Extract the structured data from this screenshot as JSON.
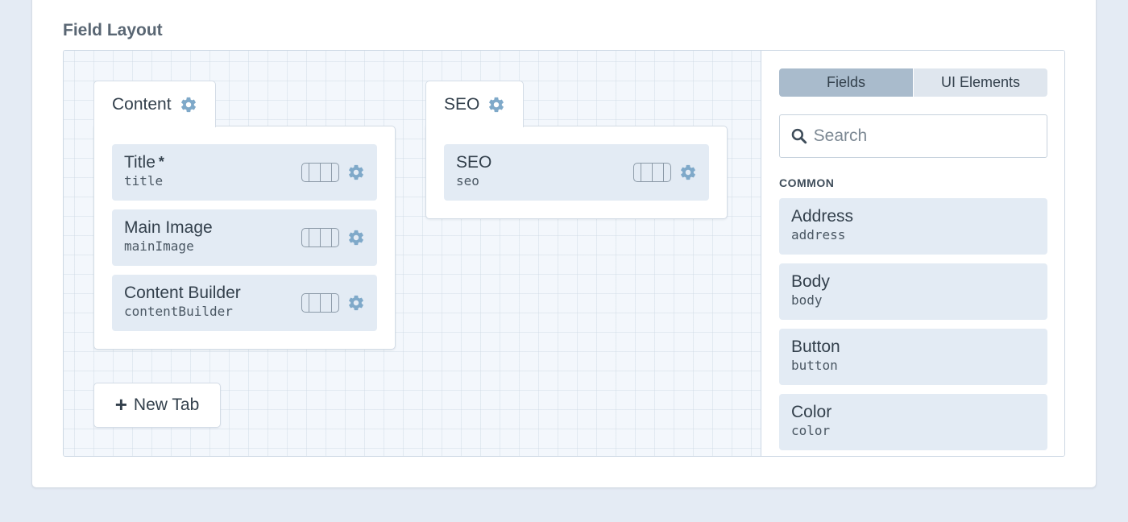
{
  "section_title": "Field Layout",
  "tabs": [
    {
      "label": "Content",
      "fields": [
        {
          "name": "Title",
          "required": true,
          "required_mark": "*",
          "handle": "title"
        },
        {
          "name": "Main Image",
          "required": false,
          "handle": "mainImage"
        },
        {
          "name": "Content Builder",
          "required": false,
          "handle": "contentBuilder"
        }
      ]
    },
    {
      "label": "SEO",
      "fields": [
        {
          "name": "SEO",
          "required": false,
          "handle": "seo"
        }
      ]
    }
  ],
  "new_tab_label": "New Tab",
  "sidebar": {
    "segments": [
      {
        "label": "Fields",
        "active": true
      },
      {
        "label": "UI Elements",
        "active": false
      }
    ],
    "search_placeholder": "Search",
    "group_label": "COMMON",
    "fields": [
      {
        "name": "Address",
        "handle": "address"
      },
      {
        "name": "Body",
        "handle": "body"
      },
      {
        "name": "Button",
        "handle": "button"
      },
      {
        "name": "Color",
        "handle": "color"
      }
    ]
  },
  "colors": {
    "gear": "#7fa9c9",
    "field_bg": "#e3ebf4",
    "page_bg": "#e4ebf4"
  },
  "icons": {
    "gear": "gear-icon",
    "search": "search-icon",
    "plus": "plus-icon",
    "width": "field-width-icon"
  }
}
